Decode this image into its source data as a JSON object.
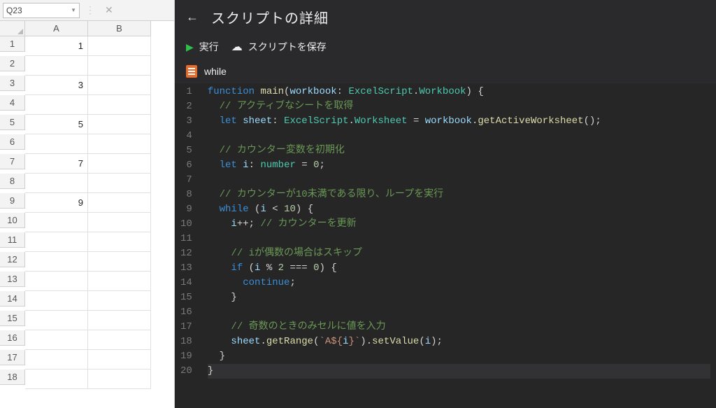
{
  "namebox": {
    "value": "Q23"
  },
  "spreadsheet": {
    "columns": [
      "A",
      "B"
    ],
    "rows": 18,
    "cells": {
      "A1": "1",
      "A3": "3",
      "A5": "5",
      "A7": "7",
      "A9": "9"
    }
  },
  "panel": {
    "title": "スクリプトの詳細",
    "run_label": "実行",
    "save_label": "スクリプトを保存",
    "script_name": "while"
  },
  "code": {
    "lines": [
      [
        [
          "kw",
          "function"
        ],
        [
          "plain",
          " "
        ],
        [
          "fn",
          "main"
        ],
        [
          "pn",
          "("
        ],
        [
          "var",
          "workbook"
        ],
        [
          "pn",
          ": "
        ],
        [
          "type",
          "ExcelScript"
        ],
        [
          "pn",
          "."
        ],
        [
          "type",
          "Workbook"
        ],
        [
          "pn",
          ") {"
        ]
      ],
      [
        [
          "plain",
          "  "
        ],
        [
          "cm",
          "// アクティブなシートを取得"
        ]
      ],
      [
        [
          "plain",
          "  "
        ],
        [
          "kw",
          "let"
        ],
        [
          "plain",
          " "
        ],
        [
          "var",
          "sheet"
        ],
        [
          "pn",
          ": "
        ],
        [
          "type",
          "ExcelScript"
        ],
        [
          "pn",
          "."
        ],
        [
          "type",
          "Worksheet"
        ],
        [
          "plain",
          " "
        ],
        [
          "op",
          "="
        ],
        [
          "plain",
          " "
        ],
        [
          "var",
          "workbook"
        ],
        [
          "pn",
          "."
        ],
        [
          "mbr",
          "getActiveWorksheet"
        ],
        [
          "pn",
          "();"
        ]
      ],
      [
        [
          "plain",
          ""
        ]
      ],
      [
        [
          "plain",
          "  "
        ],
        [
          "cm",
          "// カウンター変数を初期化"
        ]
      ],
      [
        [
          "plain",
          "  "
        ],
        [
          "kw",
          "let"
        ],
        [
          "plain",
          " "
        ],
        [
          "var",
          "i"
        ],
        [
          "pn",
          ": "
        ],
        [
          "type",
          "number"
        ],
        [
          "plain",
          " "
        ],
        [
          "op",
          "="
        ],
        [
          "plain",
          " "
        ],
        [
          "num",
          "0"
        ],
        [
          "pn",
          ";"
        ]
      ],
      [
        [
          "plain",
          ""
        ]
      ],
      [
        [
          "plain",
          "  "
        ],
        [
          "cm",
          "// カウンターが10未満である限り、ループを実行"
        ]
      ],
      [
        [
          "plain",
          "  "
        ],
        [
          "kw",
          "while"
        ],
        [
          "plain",
          " "
        ],
        [
          "pn",
          "("
        ],
        [
          "var",
          "i"
        ],
        [
          "plain",
          " "
        ],
        [
          "op",
          "<"
        ],
        [
          "plain",
          " "
        ],
        [
          "num",
          "10"
        ],
        [
          "pn",
          ") {"
        ]
      ],
      [
        [
          "plain",
          "    "
        ],
        [
          "var",
          "i"
        ],
        [
          "op",
          "++"
        ],
        [
          "pn",
          ";"
        ],
        [
          "plain",
          " "
        ],
        [
          "cm",
          "// カウンターを更新"
        ]
      ],
      [
        [
          "plain",
          ""
        ]
      ],
      [
        [
          "plain",
          "    "
        ],
        [
          "cm",
          "// iが偶数の場合はスキップ"
        ]
      ],
      [
        [
          "plain",
          "    "
        ],
        [
          "kw",
          "if"
        ],
        [
          "plain",
          " "
        ],
        [
          "pn",
          "("
        ],
        [
          "var",
          "i"
        ],
        [
          "plain",
          " "
        ],
        [
          "op",
          "%"
        ],
        [
          "plain",
          " "
        ],
        [
          "num",
          "2"
        ],
        [
          "plain",
          " "
        ],
        [
          "op",
          "==="
        ],
        [
          "plain",
          " "
        ],
        [
          "num",
          "0"
        ],
        [
          "pn",
          ") {"
        ]
      ],
      [
        [
          "plain",
          "      "
        ],
        [
          "kw",
          "continue"
        ],
        [
          "pn",
          ";"
        ]
      ],
      [
        [
          "plain",
          "    "
        ],
        [
          "pn",
          "}"
        ]
      ],
      [
        [
          "plain",
          ""
        ]
      ],
      [
        [
          "plain",
          "    "
        ],
        [
          "cm",
          "// 奇数のときのみセルに値を入力"
        ]
      ],
      [
        [
          "plain",
          "    "
        ],
        [
          "var",
          "sheet"
        ],
        [
          "pn",
          "."
        ],
        [
          "mbr",
          "getRange"
        ],
        [
          "pn",
          "("
        ],
        [
          "str",
          "`A${"
        ],
        [
          "var",
          "i"
        ],
        [
          "str",
          "}`"
        ],
        [
          "pn",
          ")."
        ],
        [
          "mbr",
          "setValue"
        ],
        [
          "pn",
          "("
        ],
        [
          "var",
          "i"
        ],
        [
          "pn",
          ");"
        ]
      ],
      [
        [
          "plain",
          "  "
        ],
        [
          "pn",
          "}"
        ]
      ],
      [
        [
          "pn",
          "}"
        ]
      ]
    ],
    "cursor_line": 20
  }
}
